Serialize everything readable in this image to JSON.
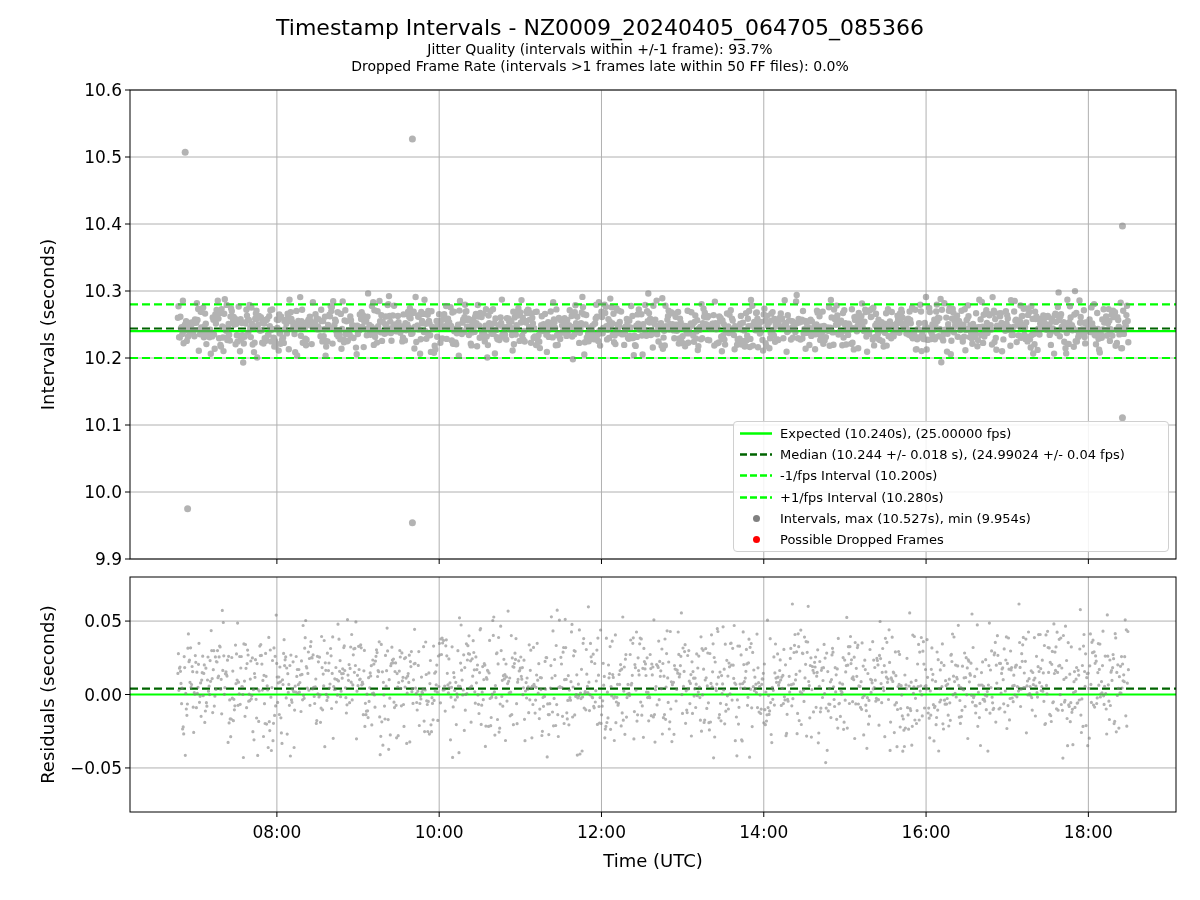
{
  "title": "Timestamp Intervals - NZ0009_20240405_064705_085366",
  "subtitles": [
    "Jitter Quality (intervals within +/-1 frame): 93.7%",
    "Dropped Frame Rate (intervals >1 frames late within 50 FF files): 0.0%"
  ],
  "interval_plot": {
    "legend": [
      {
        "label": "Expected (10.240s), (25.00000 fps)",
        "kind": "solid",
        "color": "#00ff00"
      },
      {
        "label": "Median (10.244 +/- 0.018 s), (24.99024 +/- 0.04 fps)",
        "kind": "dashed",
        "color": "#006400"
      },
      {
        "label": "-1/fps Interval (10.200s)",
        "kind": "dashed",
        "color": "#00ff00"
      },
      {
        "label": "+1/fps Interval (10.280s)",
        "kind": "dashed",
        "color": "#00ff00"
      },
      {
        "label": "Intervals, max (10.527s), min (9.954s)",
        "kind": "dot",
        "color": "#808080"
      },
      {
        "label": "Possible Dropped Frames",
        "kind": "dot",
        "color": "#ff0000"
      }
    ],
    "chart_data": {
      "type": "scatter",
      "ylabel": "Intervals (seconds)",
      "xlim": [
        6.19,
        19.08
      ],
      "ylim": [
        9.9,
        10.6
      ],
      "yticks": [
        {
          "value": 9.9,
          "label": "9.9"
        },
        {
          "value": 10.0,
          "label": "10.0"
        },
        {
          "value": 10.1,
          "label": "10.1"
        },
        {
          "value": 10.2,
          "label": "10.2"
        },
        {
          "value": 10.3,
          "label": "10.3"
        },
        {
          "value": 10.4,
          "label": "10.4"
        },
        {
          "value": 10.5,
          "label": "10.5"
        },
        {
          "value": 10.6,
          "label": "10.6"
        }
      ],
      "series": [
        {
          "color": "#808080",
          "x": [
            6.87,
            9.67,
            6.9,
            9.67,
            18.42,
            18.42
          ],
          "values": [
            10.507,
            10.527,
            9.975,
            9.954,
            10.397,
            10.111
          ]
        }
      ],
      "grid": true,
      "ref_lines": [
        {
          "axis": "y",
          "value": 10.24,
          "color": "#00ff00"
        },
        {
          "axis": "y",
          "value": 10.244,
          "color": "#006400"
        },
        {
          "axis": "y",
          "value": 10.2,
          "color": "#00ff00"
        },
        {
          "axis": "y",
          "value": 10.28,
          "color": "#00ff00"
        }
      ]
    }
  },
  "residual_plot": {
    "chart_data": {
      "type": "scatter",
      "ylabel": "Residuals (seconds)",
      "xlabel": "Time (UTC)",
      "xlim": [
        6.19,
        19.08
      ],
      "ylim": [
        -0.08,
        0.08
      ],
      "xticks": [
        {
          "value": 8,
          "label": "08:00"
        },
        {
          "value": 10,
          "label": "10:00"
        },
        {
          "value": 12,
          "label": "12:00"
        },
        {
          "value": 14,
          "label": "14:00"
        },
        {
          "value": 16,
          "label": "16:00"
        },
        {
          "value": 18,
          "label": "18:00"
        }
      ],
      "yticks": [
        {
          "value": -0.05,
          "label": "−0.05"
        },
        {
          "value": 0,
          "label": "0.00"
        },
        {
          "value": 0.05,
          "label": "0.05"
        }
      ],
      "grid": true,
      "ref_lines": [
        {
          "axis": "y",
          "value": 0,
          "color": "#00ff00"
        },
        {
          "axis": "y",
          "value": 0.004,
          "color": "#006400"
        }
      ]
    }
  }
}
